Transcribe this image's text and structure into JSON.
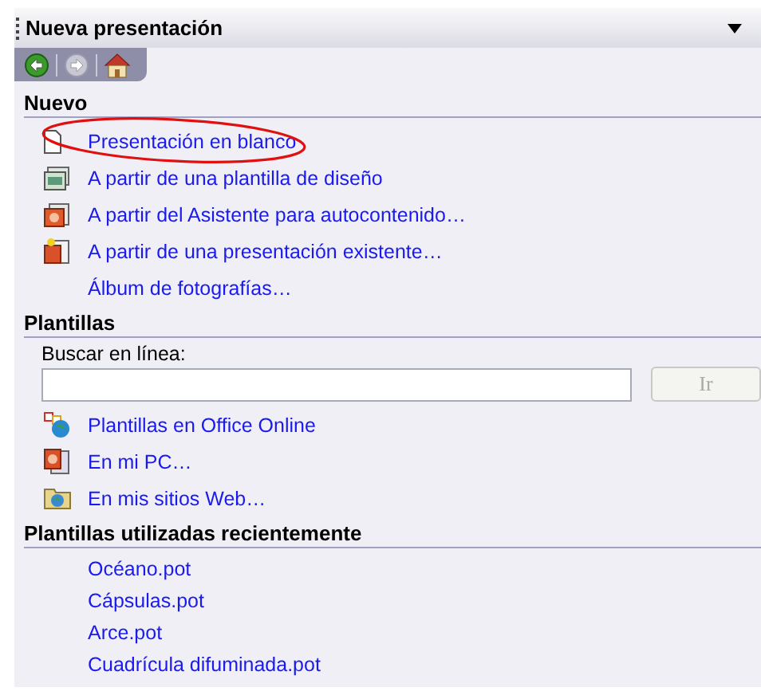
{
  "window": {
    "title": "Nueva presentación"
  },
  "nav": [
    {
      "kind": "back",
      "disabled": false
    },
    {
      "kind": "forward",
      "disabled": true
    },
    {
      "kind": "home",
      "disabled": false
    }
  ],
  "sections": [
    {
      "heading": "Nuevo",
      "links": [
        {
          "label": "Presentación en blanco",
          "kind": "blank",
          "highlighted": true
        },
        {
          "label": "A partir de una plantilla de diseño",
          "kind": "design",
          "highlighted": false
        },
        {
          "label": "A partir del Asistente para autocontenido…",
          "kind": "wizard",
          "highlighted": false
        },
        {
          "label": "A partir de una presentación existente…",
          "kind": "existing",
          "highlighted": false
        },
        {
          "label": "Álbum de fotografías…",
          "kind": "plain",
          "highlighted": false
        }
      ]
    },
    {
      "heading": "Plantillas",
      "search": {
        "label": "Buscar en línea:",
        "button": "Ir",
        "button_disabled": true
      },
      "links": [
        {
          "label": "Plantillas en Office Online",
          "kind": "online",
          "highlighted": false
        },
        {
          "label": "En mi PC…",
          "kind": "pc",
          "highlighted": false
        },
        {
          "label": "En mis sitios Web…",
          "kind": "web",
          "highlighted": false
        }
      ]
    },
    {
      "heading": "Plantillas utilizadas recientemente",
      "links": [
        {
          "label": "Océano.pot",
          "kind": "plain",
          "highlighted": false
        },
        {
          "label": "Cápsulas.pot",
          "kind": "plain",
          "highlighted": false
        },
        {
          "label": "Arce.pot",
          "kind": "plain",
          "highlighted": false
        },
        {
          "label": "Cuadrícula difuminada.pot",
          "kind": "plain",
          "highlighted": false
        }
      ]
    }
  ]
}
